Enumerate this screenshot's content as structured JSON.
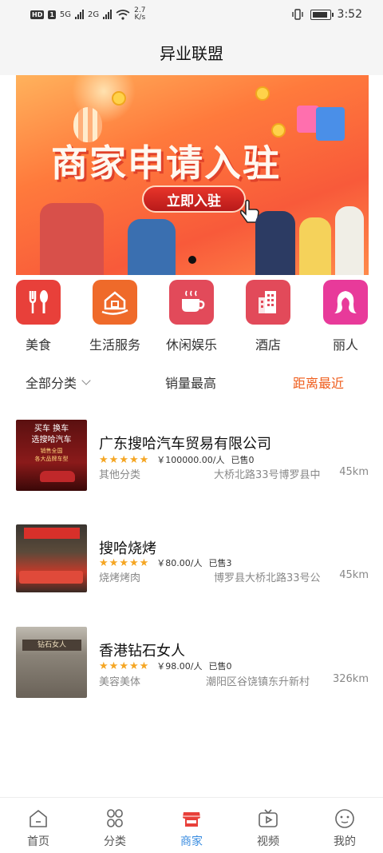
{
  "status_bar": {
    "hd_badge": "HD",
    "sim1": "1",
    "signal1": "5G",
    "signal2": "2G",
    "net_speed_value": "2.7",
    "net_speed_unit": "K/s",
    "time": "3:52"
  },
  "header": {
    "title": "异业联盟"
  },
  "banner": {
    "headline": "商家申请入驻",
    "cta": "立即入驻",
    "slide_index": 1,
    "slide_count": 1
  },
  "categories": [
    {
      "label": "美食",
      "icon": "fork-spoon-icon",
      "color": "#e8403a"
    },
    {
      "label": "生活服务",
      "icon": "house-hand-icon",
      "color": "#ef6a2a"
    },
    {
      "label": "休闲娱乐",
      "icon": "coffee-cup-icon",
      "color": "#e24a5a"
    },
    {
      "label": "酒店",
      "icon": "building-icon",
      "color": "#e24a5a"
    },
    {
      "label": "丽人",
      "icon": "woman-hair-icon",
      "color": "#e83a9a"
    }
  ],
  "filters": {
    "all": "全部分类",
    "sales": "销量最高",
    "distance": "距离最近",
    "active": "distance",
    "active_color": "#ef5d1c"
  },
  "merchants": [
    {
      "name": "广东搜哈汽车贸易有限公司",
      "rating": 5,
      "price": "￥100000.00/人",
      "sold": "已售0",
      "category": "其他分类",
      "address": "大桥北路33号博罗县中",
      "distance": "45km",
      "thumb_text1": "买车 换车",
      "thumb_text2": "选搜哈汽车",
      "thumb_text3": "销售全国",
      "thumb_text4": "各大品牌车型"
    },
    {
      "name": "搜哈烧烤",
      "rating": 5,
      "price": "￥80.00/人",
      "sold": "已售3",
      "category": "烧烤烤肉",
      "address": "博罗县大桥北路33号公",
      "distance": "45km"
    },
    {
      "name": "香港钻石女人",
      "rating": 5,
      "price": "￥98.00/人",
      "sold": "已售0",
      "category": "美容美体",
      "address": "潮阳区谷饶镇东升新村",
      "distance": "326km",
      "thumb_text1": "钻石女人"
    }
  ],
  "bottom_nav": {
    "items": [
      {
        "label": "首页",
        "icon": "home-icon"
      },
      {
        "label": "分类",
        "icon": "category-grid-icon"
      },
      {
        "label": "商家",
        "icon": "shop-icon"
      },
      {
        "label": "视频",
        "icon": "video-tv-icon"
      },
      {
        "label": "我的",
        "icon": "profile-face-icon"
      }
    ],
    "active": "商家",
    "active_color": "#3b8de0"
  }
}
